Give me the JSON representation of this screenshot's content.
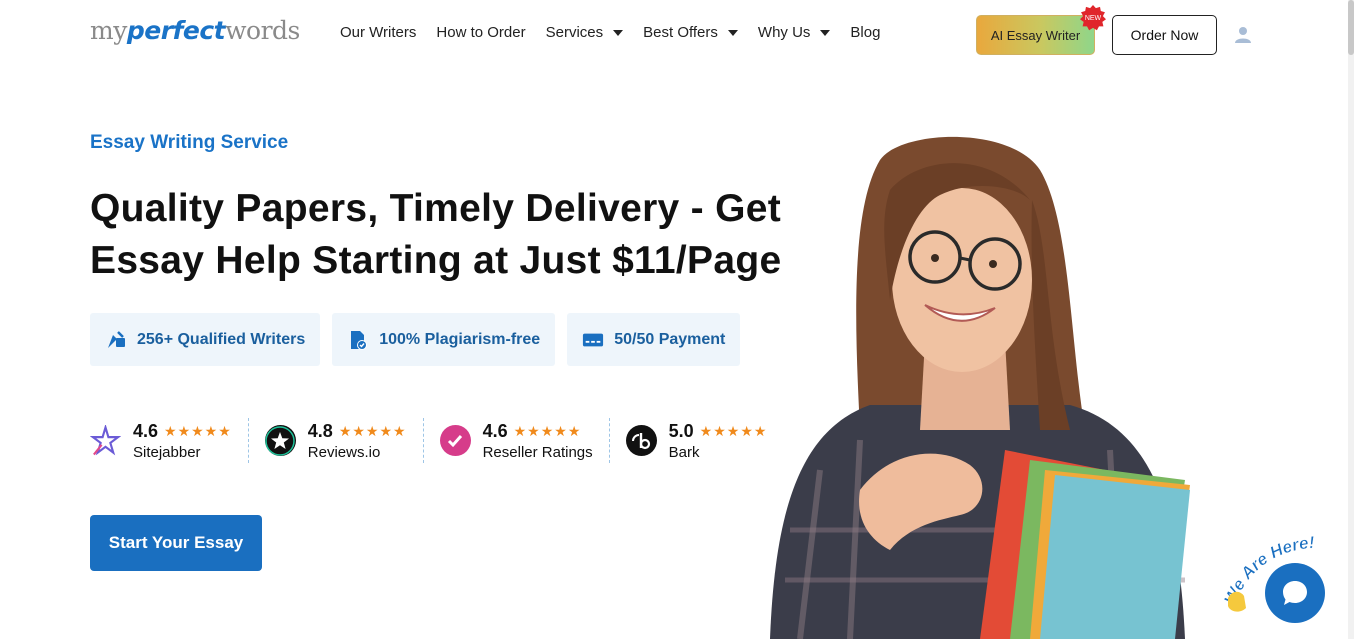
{
  "header": {
    "logo": {
      "part1": "my",
      "part2": "perfect",
      "part3": "words"
    },
    "nav": [
      {
        "label": "Our Writers",
        "dropdown": false
      },
      {
        "label": "How to Order",
        "dropdown": false
      },
      {
        "label": "Services",
        "dropdown": true
      },
      {
        "label": "Best Offers",
        "dropdown": true
      },
      {
        "label": "Why Us",
        "dropdown": true
      },
      {
        "label": "Blog",
        "dropdown": false
      }
    ],
    "ai_button": "AI Essay Writer",
    "new_badge": "NEW",
    "order_button": "Order Now"
  },
  "hero": {
    "eyebrow": "Essay Writing Service",
    "headline_line1": "Quality Papers, Timely Delivery - Get",
    "headline_line2": "Essay Help Starting at Just $11/Page",
    "features": [
      {
        "icon": "writer-icon",
        "label": "256+ Qualified Writers"
      },
      {
        "icon": "document-check-icon",
        "label": "100% Plagiarism-free"
      },
      {
        "icon": "card-icon",
        "label": "50/50 Payment"
      }
    ],
    "ratings": [
      {
        "icon": "sitejabber-logo-icon",
        "score": "4.6",
        "stars": "★★★★★",
        "name": "Sitejabber"
      },
      {
        "icon": "reviewsio-logo-icon",
        "score": "4.8",
        "stars": "★★★★★",
        "name": "Reviews.io"
      },
      {
        "icon": "resellerratings-logo-icon",
        "score": "4.6",
        "stars": "★★★★★",
        "name": "Reseller Ratings"
      },
      {
        "icon": "bark-logo-icon",
        "score": "5.0",
        "stars": "★★★★★",
        "name": "Bark"
      }
    ],
    "cta": "Start Your Essay"
  },
  "chat": {
    "tagline": "We Are Here!"
  },
  "colors": {
    "brand_blue": "#1a73c7",
    "cta_blue": "#1a6fc0",
    "star_orange": "#f08a1c",
    "feature_bg": "#eef5fb"
  }
}
